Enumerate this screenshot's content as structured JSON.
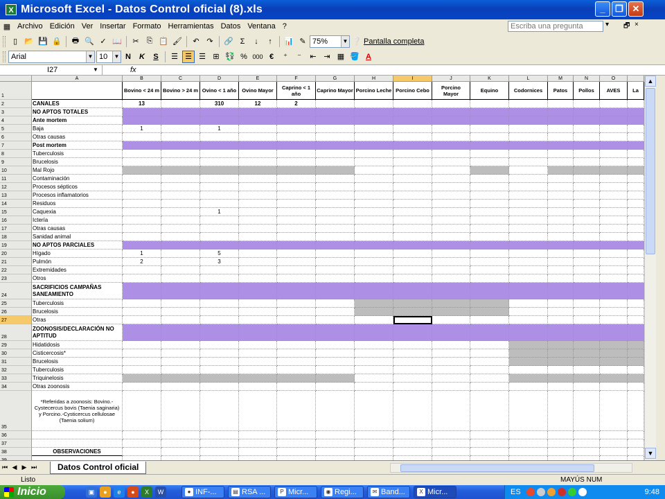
{
  "window": {
    "title": "Microsoft Excel - Datos Control oficial (8).xls"
  },
  "menu": {
    "items": [
      {
        "label": "Archivo"
      },
      {
        "label": "Edición"
      },
      {
        "label": "Ver"
      },
      {
        "label": "Insertar"
      },
      {
        "label": "Formato"
      },
      {
        "label": "Herramientas"
      },
      {
        "label": "Datos"
      },
      {
        "label": "Ventana"
      },
      {
        "label": "?"
      }
    ],
    "ask_placeholder": "Escriba una pregunta"
  },
  "toolbar": {
    "zoom": "75%",
    "fullscreen_label": "Pantalla completa",
    "font_name": "Arial",
    "font_size": "10",
    "bold": "N",
    "italic": "K",
    "underline": "S",
    "percent": "%",
    "thousands": "000",
    "euro": "€"
  },
  "formula_bar": {
    "name_box": "I27",
    "fx": "fx",
    "value": ""
  },
  "grid": {
    "columns": [
      "A",
      "B",
      "C",
      "D",
      "E",
      "F",
      "G",
      "H",
      "I",
      "J",
      "K",
      "L",
      "M",
      "N",
      "O"
    ],
    "selected_column": "I",
    "selected_row": "27",
    "header_row": [
      "",
      "Bovino < 24 m",
      "Bovino > 24 m",
      "Ovino < 1 año",
      "Ovino Mayor",
      "Caprino < 1 año",
      "Caprino Mayor",
      "Porcino Leche",
      "Porcino Cebo",
      "Porcino Mayor",
      "Equino",
      "Codornices",
      "Patos",
      "Pollos",
      "AVES",
      "La"
    ],
    "rows": [
      {
        "num": "2",
        "a": "CANALES",
        "b": "13",
        "d": "310",
        "e": "12",
        "f": "2"
      },
      {
        "num": "3",
        "a": "NO APTOS TOTALES"
      },
      {
        "num": "4",
        "a": "Ante mortem"
      },
      {
        "num": "5",
        "a": "Baja",
        "b": "1",
        "d": "1"
      },
      {
        "num": "6",
        "a": "Otras causas"
      },
      {
        "num": "7",
        "a": "Post mortem"
      },
      {
        "num": "8",
        "a": "Tuberculosis"
      },
      {
        "num": "9",
        "a": "Brucelosis"
      },
      {
        "num": "10",
        "a": "Mal Rojo"
      },
      {
        "num": "11",
        "a": "Contaminación"
      },
      {
        "num": "12",
        "a": "Procesos sépticos"
      },
      {
        "num": "13",
        "a": "Procesos inflamatorios"
      },
      {
        "num": "14",
        "a": "Residuos"
      },
      {
        "num": "15",
        "a": "Caquexia",
        "d": "1"
      },
      {
        "num": "16",
        "a": "Ictería"
      },
      {
        "num": "17",
        "a": "Otras causas"
      },
      {
        "num": "18",
        "a": "Sanidad animal"
      },
      {
        "num": "19",
        "a": "NO APTOS PARCIALES"
      },
      {
        "num": "20",
        "a": "Hígado",
        "b": "1",
        "d": "5"
      },
      {
        "num": "21",
        "a": "Pulmón",
        "b": "2",
        "d": "3"
      },
      {
        "num": "22",
        "a": "Extremidades"
      },
      {
        "num": "23",
        "a": "Otros"
      },
      {
        "num": "24",
        "a": "SACRIFICIOS CAMPAÑAS SANEAMIENTO"
      },
      {
        "num": "25",
        "a": "Tuberculosis"
      },
      {
        "num": "26",
        "a": "Brucelosis"
      },
      {
        "num": "27",
        "a": "Otras"
      },
      {
        "num": "28",
        "a": "ZOONOSIS/DECLARACIÓN NO APTITUD"
      },
      {
        "num": "29",
        "a": "Hidatidosis"
      },
      {
        "num": "30",
        "a": "Cisticercosis*"
      },
      {
        "num": "31",
        "a": "Brucelosis"
      },
      {
        "num": "32",
        "a": "Tuberculosis"
      },
      {
        "num": "33",
        "a": "Triquinelosis"
      },
      {
        "num": "34",
        "a": "Otras zoonosis"
      },
      {
        "num": "35",
        "a": "*Referidas a zoonosis: Bovino.-Cystecercus bovis (Taenia saginaria) y Porcino.-Cysticercus cellulosae (Taenia solium)"
      },
      {
        "num": "36",
        "a": ""
      },
      {
        "num": "37",
        "a": ""
      },
      {
        "num": "38",
        "a": "OBSERVACIONES"
      },
      {
        "num": "39",
        "a": ""
      }
    ]
  },
  "sheet_tabs": {
    "active": "Datos Control oficial"
  },
  "status": {
    "left": "Listo",
    "right": "MAYÚS NUM"
  },
  "taskbar": {
    "start": "Inicio",
    "tasks": [
      {
        "label": "INF-..."
      },
      {
        "label": "RSA ..."
      },
      {
        "label": "Micr..."
      },
      {
        "label": "Regi..."
      },
      {
        "label": "Band..."
      },
      {
        "label": "Micr..."
      }
    ],
    "lang": "ES",
    "clock": "9:48"
  }
}
